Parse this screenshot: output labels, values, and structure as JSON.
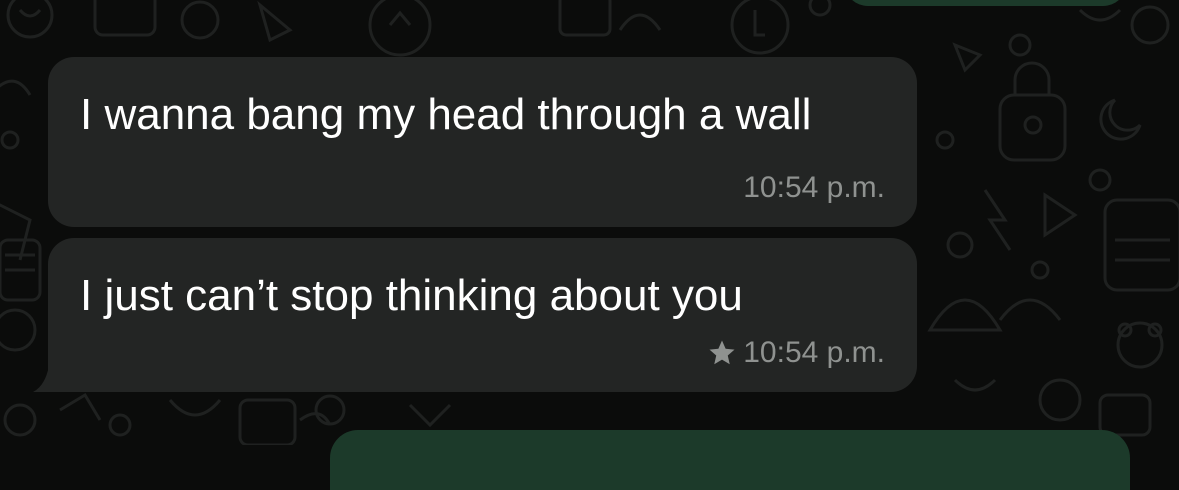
{
  "chat": {
    "messages": [
      {
        "text": "I wanna bang my head through a wall",
        "time": "10:54 p.m.",
        "starred": false
      },
      {
        "text": "I just can’t stop thinking about you",
        "time": "10:54 p.m.",
        "starred": true
      }
    ]
  },
  "theme": {
    "background": "#0b0c0b",
    "incoming_bubble": "#232524",
    "outgoing_bubble": "#1c3a2a",
    "text": "#ffffff",
    "meta_text": "#8f9290"
  },
  "icons": {
    "star": "star-icon"
  }
}
